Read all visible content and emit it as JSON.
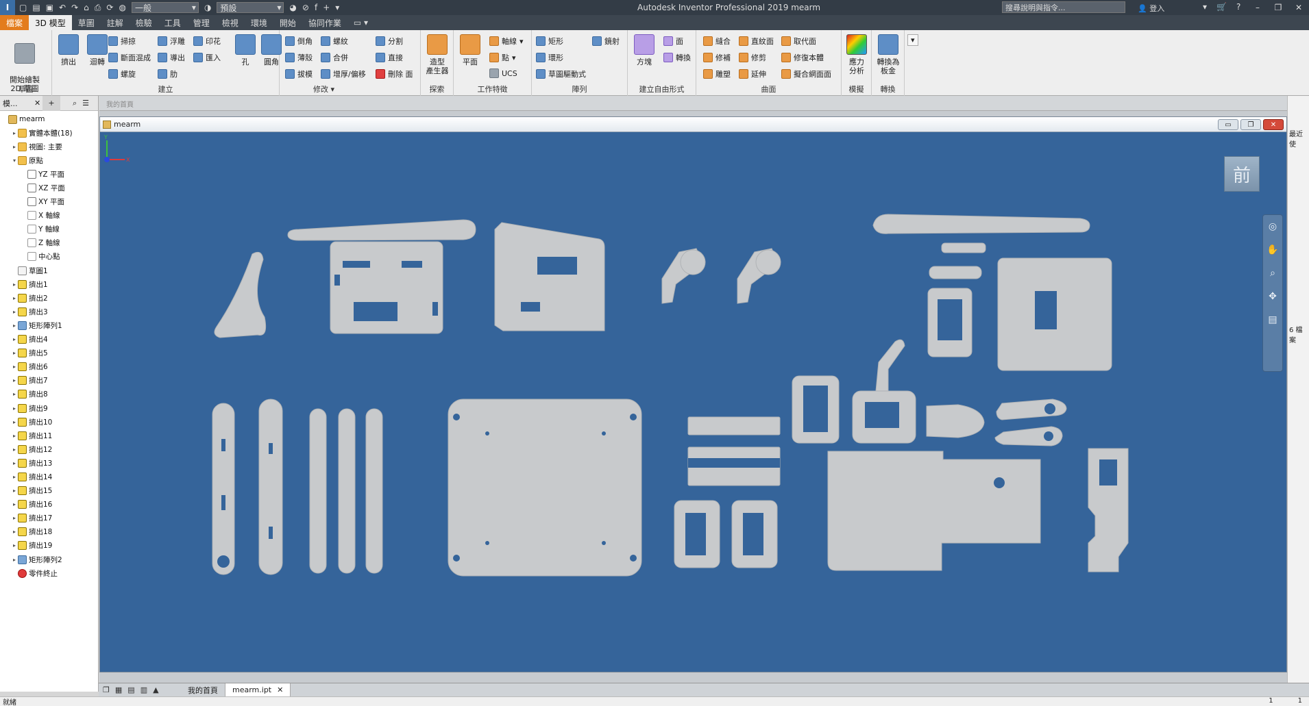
{
  "titlebar": {
    "logo": "I",
    "style_combo": "一般",
    "appearance_combo": "預設",
    "fx": "f",
    "app_title": "Autodesk Inventor Professional 2019    mearm",
    "help_search_placeholder": "搜尋說明與指令...",
    "signin": "登入"
  },
  "tabs": [
    "檔案",
    "3D 模型",
    "草圖",
    "註解",
    "檢驗",
    "工具",
    "管理",
    "檢視",
    "環境",
    "開始",
    "協同作業"
  ],
  "ribbon": {
    "sketch_panel": {
      "label": "草圖",
      "start_2d": "開始繪製\n2D 草圖"
    },
    "create_panel": {
      "label": "建立",
      "extrude": "擠出",
      "revolve": "迴轉",
      "sweep": "掃掠",
      "loft": "斷面混成",
      "coil": "螺旋",
      "emboss": "浮雕",
      "derive": "導出",
      "rib": "肋",
      "decal": "印花",
      "import": "匯入"
    },
    "modify_panel": {
      "label": "修改",
      "hole": "孔",
      "fillet": "圓角",
      "chamfer": "倒角",
      "shell": "薄殼",
      "draft": "拔模",
      "thread": "螺紋",
      "combine": "合併",
      "thicken": "增厚/偏移",
      "split": "分割",
      "direct": "直接",
      "delete_face": "刪除 面"
    },
    "explore_panel": {
      "label": "探索",
      "shape_gen": "造型\n產生器"
    },
    "work_panel": {
      "label": "工作特徵",
      "plane": "平面",
      "axis": "軸線",
      "point": "點",
      "ucs": "UCS"
    },
    "pattern_panel": {
      "label": "陣列",
      "rect": "矩形",
      "circ": "環形",
      "sketch_driven": "草圖驅動式",
      "mirror": "鏡射"
    },
    "freeform_panel": {
      "label": "建立自由形式",
      "box": "方塊",
      "face": "面",
      "convert": "轉換"
    },
    "surface_panel": {
      "label": "曲面",
      "stitch": "縫合",
      "patch": "修補",
      "sculpt": "雕塑",
      "ruled": "直紋面",
      "trim": "修剪",
      "extend": "延伸",
      "replace": "取代面",
      "repair": "修復本體",
      "fit_mesh": "擬合網面面"
    },
    "sim_panel": {
      "label": "模擬",
      "stress": "應力\n分析"
    },
    "convert_panel": {
      "label": "轉換",
      "sheet_metal": "轉換為\n板金"
    }
  },
  "browser": {
    "title": "模...",
    "items": [
      {
        "label": "mearm",
        "icon": "part",
        "indent": 0,
        "exp": ""
      },
      {
        "label": "實體本體(18)",
        "icon": "folder",
        "indent": 1,
        "exp": "▸"
      },
      {
        "label": "視圖: 主要",
        "icon": "folder",
        "indent": 1,
        "exp": "▸"
      },
      {
        "label": "原點",
        "icon": "folder",
        "indent": 1,
        "exp": "▾"
      },
      {
        "label": "YZ 平面",
        "icon": "plane",
        "indent": 2,
        "exp": ""
      },
      {
        "label": "XZ 平面",
        "icon": "plane",
        "indent": 2,
        "exp": ""
      },
      {
        "label": "XY 平面",
        "icon": "plane",
        "indent": 2,
        "exp": ""
      },
      {
        "label": "X 軸線",
        "icon": "axis",
        "indent": 2,
        "exp": ""
      },
      {
        "label": "Y 軸線",
        "icon": "axis",
        "indent": 2,
        "exp": ""
      },
      {
        "label": "Z 軸線",
        "icon": "axis",
        "indent": 2,
        "exp": ""
      },
      {
        "label": "中心點",
        "icon": "axis",
        "indent": 2,
        "exp": ""
      },
      {
        "label": "草圖1",
        "icon": "sketch",
        "indent": 1,
        "exp": ""
      },
      {
        "label": "擠出1",
        "icon": "ext",
        "indent": 1,
        "exp": "▸"
      },
      {
        "label": "擠出2",
        "icon": "ext",
        "indent": 1,
        "exp": "▸"
      },
      {
        "label": "擠出3",
        "icon": "ext",
        "indent": 1,
        "exp": "▸"
      },
      {
        "label": "矩形陣列1",
        "icon": "pat",
        "indent": 1,
        "exp": "▸"
      },
      {
        "label": "擠出4",
        "icon": "ext",
        "indent": 1,
        "exp": "▸"
      },
      {
        "label": "擠出5",
        "icon": "ext",
        "indent": 1,
        "exp": "▸"
      },
      {
        "label": "擠出6",
        "icon": "ext",
        "indent": 1,
        "exp": "▸"
      },
      {
        "label": "擠出7",
        "icon": "ext",
        "indent": 1,
        "exp": "▸"
      },
      {
        "label": "擠出8",
        "icon": "ext",
        "indent": 1,
        "exp": "▸"
      },
      {
        "label": "擠出9",
        "icon": "ext",
        "indent": 1,
        "exp": "▸"
      },
      {
        "label": "擠出10",
        "icon": "ext",
        "indent": 1,
        "exp": "▸"
      },
      {
        "label": "擠出11",
        "icon": "ext",
        "indent": 1,
        "exp": "▸"
      },
      {
        "label": "擠出12",
        "icon": "ext",
        "indent": 1,
        "exp": "▸"
      },
      {
        "label": "擠出13",
        "icon": "ext",
        "indent": 1,
        "exp": "▸"
      },
      {
        "label": "擠出14",
        "icon": "ext",
        "indent": 1,
        "exp": "▸"
      },
      {
        "label": "擠出15",
        "icon": "ext",
        "indent": 1,
        "exp": "▸"
      },
      {
        "label": "擠出16",
        "icon": "ext",
        "indent": 1,
        "exp": "▸"
      },
      {
        "label": "擠出17",
        "icon": "ext",
        "indent": 1,
        "exp": "▸"
      },
      {
        "label": "擠出18",
        "icon": "ext",
        "indent": 1,
        "exp": "▸"
      },
      {
        "label": "擠出19",
        "icon": "ext",
        "indent": 1,
        "exp": "▸"
      },
      {
        "label": "矩形陣列2",
        "icon": "pat",
        "indent": 1,
        "exp": "▸"
      },
      {
        "label": "零件終止",
        "icon": "end",
        "indent": 1,
        "exp": ""
      }
    ]
  },
  "document": {
    "ghost_tab": "我的首頁",
    "window_title": "mearm",
    "viewcube_label": "前",
    "triad": {
      "y": "Y",
      "x": "X"
    }
  },
  "right_strip": {
    "t1": "最近使",
    "t2": "6 檔案"
  },
  "bottom_tabs": [
    {
      "label": "我的首頁",
      "active": false
    },
    {
      "label": "mearm.ipt",
      "active": true
    }
  ],
  "status": {
    "text": "就緒",
    "n1": "1",
    "n2": "1"
  },
  "colors": {
    "viewport_bg": "#35649a",
    "part_fill": "#c8cacc",
    "file_tab": "#e37c1d"
  }
}
